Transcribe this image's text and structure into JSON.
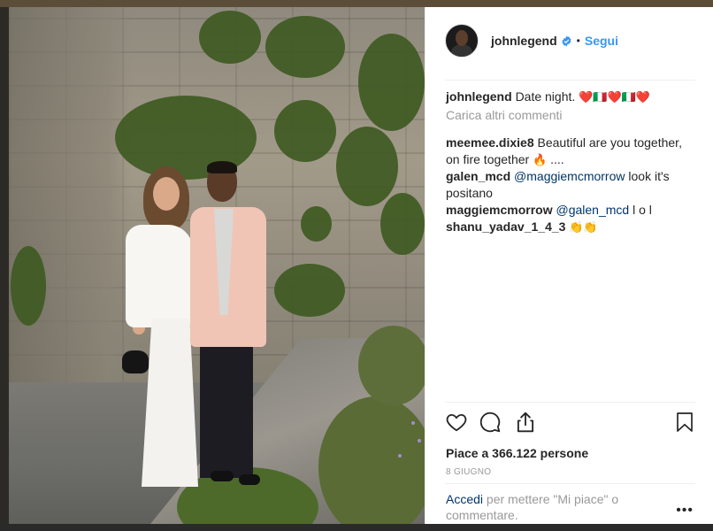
{
  "post": {
    "username": "johnlegend",
    "follow_label": "Segui",
    "separator": "•",
    "caption_user": "johnlegend",
    "caption_text": "Date night.",
    "caption_emoji": "❤️🇮🇹❤️🇮🇹❤️",
    "load_more": "Carica altri commenti",
    "likes": "Piace a 366.122 persone",
    "date": "8 GIUGNO",
    "add_comment_link": "Accedi",
    "add_comment_rest": " per mettere \"Mi piace\" o commentare.",
    "more_options": "•••"
  },
  "comments": [
    {
      "user": "meemee.dixie8",
      "text_before": " Beautiful are you together, on fire together ",
      "emoji": "🔥",
      "text_after": " ...."
    },
    {
      "user": "galen_mcd",
      "mention": "@maggiemcmorrow",
      "text_after": " look it's positano"
    },
    {
      "user": "maggiemcmorrow",
      "mention": "@galen_mcd",
      "text_after": " l o l"
    },
    {
      "user": "shanu_yadav_1_4_3",
      "emoji": " 👏👏"
    }
  ],
  "icons": {
    "like": "heart-icon",
    "comment": "comment-bubble-icon",
    "share": "share-icon",
    "save": "bookmark-icon",
    "verified": "verified-badge-icon"
  },
  "colors": {
    "accent": "#3897f0",
    "mention": "#003569",
    "text": "#262626",
    "muted": "#999999"
  }
}
